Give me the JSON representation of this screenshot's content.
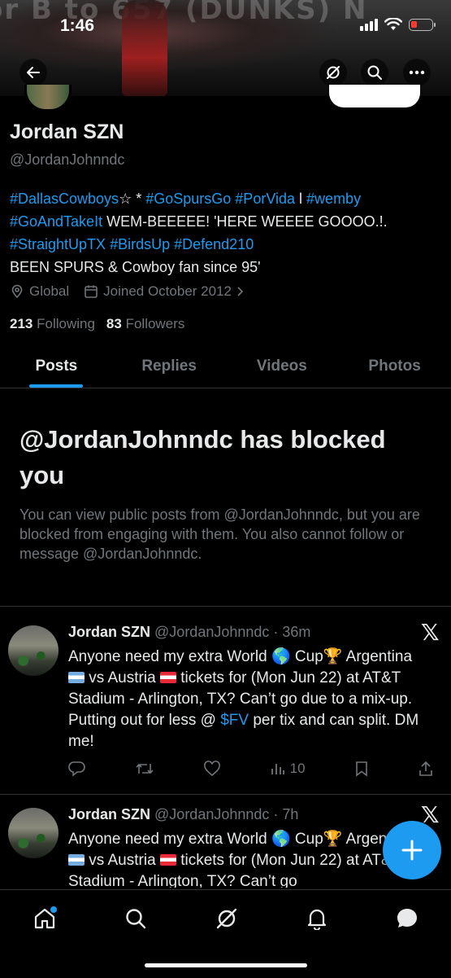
{
  "status_bar": {
    "time": "1:46"
  },
  "banner": {
    "text": "or B to 657 (DUNKS) N"
  },
  "profile": {
    "name": "Jordan SZN",
    "handle": "@JordanJohnndc",
    "bio": {
      "line1_links": [
        "#DallasCowboys"
      ],
      "line1_star": "☆",
      "line1_mid": " * ",
      "line1_links2": [
        "#GoSpursGo",
        "#PorVida"
      ],
      "line1_sep": " l ",
      "line1_link3": "#wemby",
      "line2_link": "#GoAndTakeIt",
      "line2_text": " WEM-BEEEEE! 'HERE WEEEE GOOOO.!.",
      "line3_links": [
        "#StraightUpTX",
        "#BirdsUp",
        "#Defend210"
      ],
      "line4_text": "BEEN SPURS & Cowboy fan since 95'"
    },
    "location": "Global",
    "joined": "Joined October 2012",
    "following_count": "213",
    "following_label": "Following",
    "followers_count": "83",
    "followers_label": "Followers"
  },
  "tabs": [
    {
      "label": "Posts",
      "active": true
    },
    {
      "label": "Replies",
      "active": false
    },
    {
      "label": "Videos",
      "active": false
    },
    {
      "label": "Photos",
      "active": false
    }
  ],
  "blocked": {
    "title": "@JordanJohnndc has blocked you",
    "body": "You can view public posts from @JordanJohnndc, but you are blocked from engaging with them. You also cannot follow or message @JordanJohnndc."
  },
  "posts": [
    {
      "name": "Jordan SZN",
      "handle_time": "@JordanJohnndc · 36m",
      "text_a": "Anyone need my extra World ",
      "text_b": " Cup",
      "text_c": "Argentina ",
      "text_d": " vs Austria ",
      "text_e": " tickets for (Mon Jun 22) at AT&T Stadium - Arlington, TX? Can’t go due to a mix-up. Putting out for less @ ",
      "cashtag": "$FV",
      "text_f": " per tix and can split. DM me!",
      "views": "10"
    },
    {
      "name": "Jordan SZN",
      "handle_time": "@JordanJohnndc · 7h",
      "text_a": "Anyone need my extra World ",
      "text_b": " Cup",
      "text_c": "Argentina ",
      "text_d": " vs Austria ",
      "text_e": " tickets for (Mon Jun 22) at AT&T Stadium - Arlington, TX? Can’t go"
    }
  ],
  "icons": {
    "globe": "🌎",
    "trophy": "🏆"
  },
  "colors": {
    "accent": "#1d9bf0",
    "background": "#000000",
    "muted": "#71767b",
    "text": "#e7e9ea"
  }
}
